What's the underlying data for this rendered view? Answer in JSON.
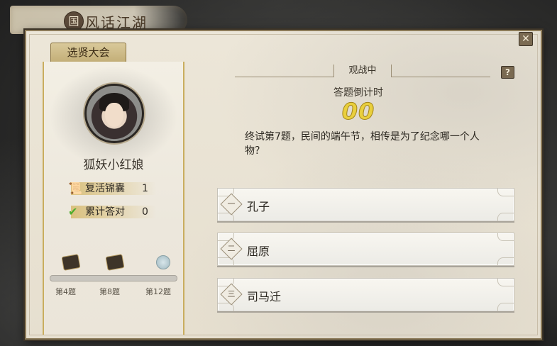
{
  "game": {
    "title": "风话江湖",
    "title_seal": "国"
  },
  "tab": {
    "label": "选贤大会"
  },
  "close_label": "✕",
  "player": {
    "name": "狐妖小红娘",
    "revive_label": "复活锦囊",
    "revive_count": "1",
    "correct_label": "累计答对",
    "correct_count": "0"
  },
  "progress": {
    "fraction": 0,
    "milestones": [
      "第4题",
      "第8题",
      "第12题"
    ]
  },
  "status": {
    "watching": "观战中",
    "help": "?"
  },
  "countdown": {
    "label": "答题倒计时",
    "value": "00"
  },
  "question": {
    "text": "终试第7题，民间的端午节，相传是为了纪念哪一个人物？"
  },
  "options": [
    {
      "num": "一",
      "text": "孔子"
    },
    {
      "num": "二",
      "text": "屈原"
    },
    {
      "num": "三",
      "text": "司马迁"
    }
  ]
}
